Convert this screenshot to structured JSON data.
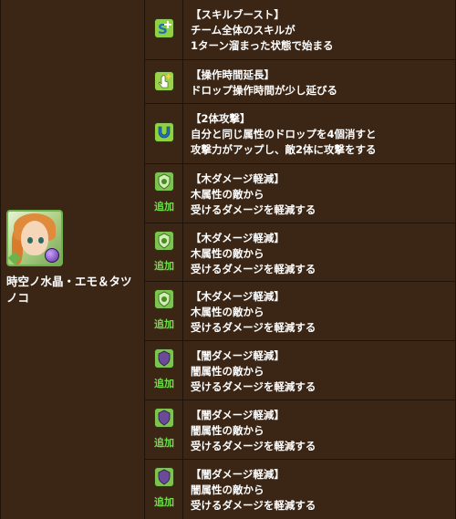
{
  "character": {
    "name": "時空ノ水晶・エモ＆タツノコ"
  },
  "awakenings": [
    {
      "icon": "skill-boost-icon",
      "added": false,
      "added_label": "",
      "title": "【スキルブースト】",
      "lines": [
        "チーム全体のスキルが",
        "1ターン溜まった状態で始まる"
      ]
    },
    {
      "icon": "time-extend-icon",
      "added": false,
      "added_label": "",
      "title": "【操作時間延長】",
      "lines": [
        "ドロップ操作時間が少し延びる"
      ]
    },
    {
      "icon": "two-pronged-icon",
      "added": false,
      "added_label": "",
      "title": "【2体攻撃】",
      "lines": [
        "自分と同じ属性のドロップを4個消すと",
        "攻撃力がアップし、敵2体に攻撃をする"
      ]
    },
    {
      "icon": "wood-resist-icon",
      "added": true,
      "added_label": "追加",
      "title": "【木ダメージ軽減】",
      "lines": [
        "木属性の敵から",
        "受けるダメージを軽減する"
      ]
    },
    {
      "icon": "wood-resist-icon",
      "added": true,
      "added_label": "追加",
      "title": "【木ダメージ軽減】",
      "lines": [
        "木属性の敵から",
        "受けるダメージを軽減する"
      ]
    },
    {
      "icon": "wood-resist-icon",
      "added": true,
      "added_label": "追加",
      "title": "【木ダメージ軽減】",
      "lines": [
        "木属性の敵から",
        "受けるダメージを軽減する"
      ]
    },
    {
      "icon": "dark-resist-icon",
      "added": true,
      "added_label": "追加",
      "title": "【闇ダメージ軽減】",
      "lines": [
        "闇属性の敵から",
        "受けるダメージを軽減する"
      ]
    },
    {
      "icon": "dark-resist-icon",
      "added": true,
      "added_label": "追加",
      "title": "【闇ダメージ軽減】",
      "lines": [
        "闇属性の敵から",
        "受けるダメージを軽減する"
      ]
    },
    {
      "icon": "dark-resist-icon",
      "added": true,
      "added_label": "追加",
      "title": "【闇ダメージ軽減】",
      "lines": [
        "闇属性の敵から",
        "受けるダメージを軽減する"
      ]
    }
  ],
  "colors": {
    "background": "#3b2616",
    "border": "#1e1209",
    "added_label": "#6fe04a",
    "icon_green": "#7fc23a",
    "icon_purple": "#6b4a9a"
  }
}
